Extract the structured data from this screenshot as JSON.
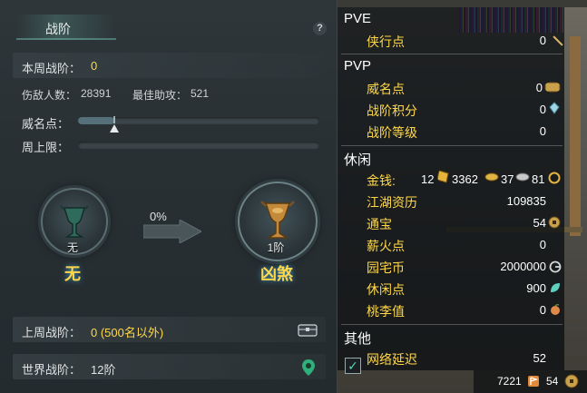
{
  "left_panel": {
    "title": "战阶",
    "help_label": "?",
    "weekly_rank_label": "本周战阶：",
    "weekly_rank_value": "0",
    "injured_label": "伤敌人数：",
    "injured_value": "28391",
    "best_assist_label": "最佳助攻：",
    "best_assist_value": "521",
    "prestige_label": "威名点：",
    "prestige_progress": 0.15,
    "weekly_cap_label": "周上限：",
    "weekly_cap_progress": 0,
    "current_rank_level": "无",
    "current_rank_name": "无",
    "progress_percent": "0%",
    "next_rank_level": "1阶",
    "next_rank_name": "凶煞",
    "last_week_label": "上周战阶：",
    "last_week_value": "0 (500名以外)",
    "world_rank_label": "世界战阶：",
    "world_rank_value": "12阶",
    "icons": [
      "chest-icon",
      "map-pin-icon",
      "goblet-icon"
    ],
    "accent": "#ffd84a"
  },
  "right_panel": {
    "sections": {
      "pve": {
        "title": "PVE",
        "items": [
          {
            "label": "侠行点",
            "value": "0",
            "icon": "sword-icon"
          }
        ]
      },
      "pvp": {
        "title": "PVP",
        "items": [
          {
            "label": "威名点",
            "value": "0",
            "icon": "prestige-token-icon"
          },
          {
            "label": "战阶积分",
            "value": "0",
            "icon": "crystal-icon"
          },
          {
            "label": "战阶等级",
            "value": "0",
            "icon": ""
          }
        ]
      },
      "leisure": {
        "title": "休闲",
        "money_label": "金钱:",
        "money_gold": "12",
        "money_silver": "3362",
        "money_copper": "37",
        "money_coin": "81",
        "items": [
          {
            "label": "江湖资历",
            "value": "109835",
            "icon": ""
          },
          {
            "label": "通宝",
            "value": "54",
            "icon": "coin-icon"
          },
          {
            "label": "薪火点",
            "value": "0",
            "icon": ""
          },
          {
            "label": "园宅币",
            "value": "2000000",
            "icon": "g-coin-icon"
          },
          {
            "label": "休闲点",
            "value": "900",
            "icon": "leaf-icon"
          },
          {
            "label": "桃李值",
            "value": "0",
            "icon": "peach-icon"
          }
        ]
      },
      "other": {
        "title": "其他",
        "latency_label": "网络延迟",
        "latency_value": "52",
        "latency_checked": true
      }
    },
    "bottom": {
      "left_value": "7221",
      "right_value": "54"
    }
  }
}
